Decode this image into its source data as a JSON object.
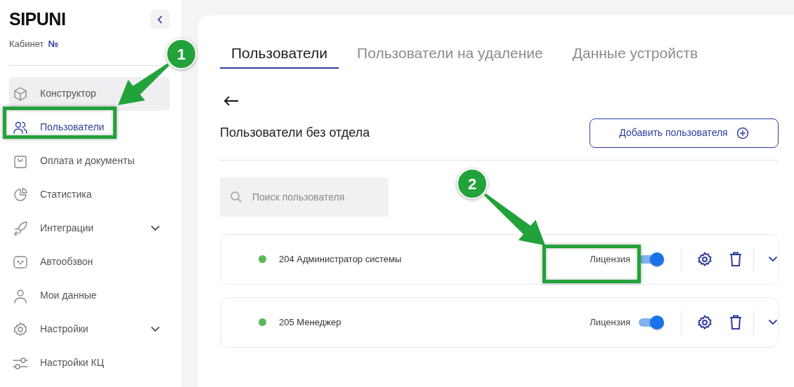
{
  "sidebar": {
    "logo": "SIPUNI",
    "account_label": "Кабинет",
    "account_number": "№",
    "items": [
      {
        "label": "Конструктор",
        "selected": false,
        "highlighted": true,
        "kind": "link"
      },
      {
        "label": "Пользователи",
        "selected": true,
        "highlighted": false,
        "kind": "link"
      },
      {
        "label": "Оплата и документы",
        "selected": false,
        "highlighted": false,
        "kind": "link"
      },
      {
        "label": "Статистика",
        "selected": false,
        "highlighted": false,
        "kind": "link"
      },
      {
        "label": "Интеграции",
        "selected": false,
        "highlighted": false,
        "kind": "group"
      },
      {
        "label": "Автообзвон",
        "selected": false,
        "highlighted": false,
        "kind": "link"
      },
      {
        "label": "Мои данные",
        "selected": false,
        "highlighted": false,
        "kind": "link"
      },
      {
        "label": "Настройки",
        "selected": false,
        "highlighted": false,
        "kind": "group"
      },
      {
        "label": "Настройки КЦ",
        "selected": false,
        "highlighted": false,
        "kind": "link"
      }
    ]
  },
  "tabs": [
    {
      "label": "Пользователи",
      "selected": true
    },
    {
      "label": "Пользователи на удаление",
      "selected": false
    },
    {
      "label": "Данные устройств",
      "selected": false
    }
  ],
  "section_title": "Пользователи без отдела",
  "add_button": "Добавить пользователя",
  "search": {
    "placeholder": "Поиск пользователя"
  },
  "users": [
    {
      "name": "204 Администратор системы",
      "color": "#5cb85c",
      "license_label": "Лицензия",
      "license_on": true
    },
    {
      "name": "205 Менеджер",
      "color": "#5cb85c",
      "license_label": "Лицензия",
      "license_on": true
    }
  ],
  "annotations": [
    {
      "number": "1"
    },
    {
      "number": "2"
    }
  ]
}
